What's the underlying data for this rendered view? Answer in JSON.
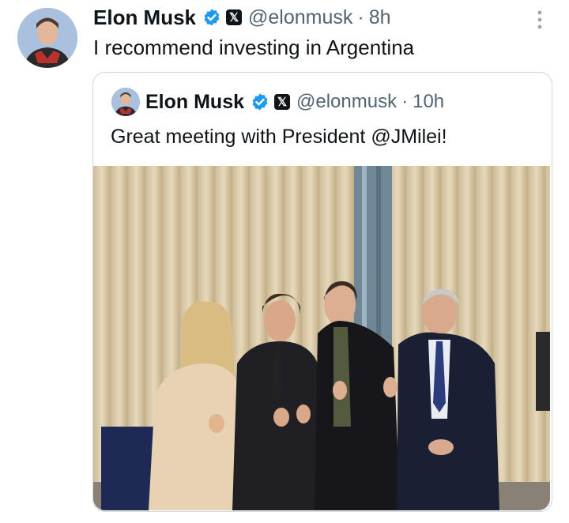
{
  "tweet": {
    "author_name": "Elon Musk",
    "handle": "@elonmusk",
    "separator": "·",
    "time": "8h",
    "text": "I recommend investing in Argentina",
    "avatar_icon": "elon-musk-avatar",
    "verified_icon": "verified-badge-icon",
    "affiliate_icon": "x-logo-icon",
    "more_icon": "more-vertical-icon"
  },
  "quoted_tweet": {
    "author_name": "Elon Musk",
    "handle": "@elonmusk",
    "separator": "·",
    "time": "10h",
    "text": "Great meeting with President @JMilei!",
    "image": "Photo of four people giving thumbs up in front of curtains"
  },
  "colors": {
    "text": "#0f1419",
    "secondary": "#536471",
    "verified": "#1d9bf0",
    "border": "#cfd9de"
  }
}
